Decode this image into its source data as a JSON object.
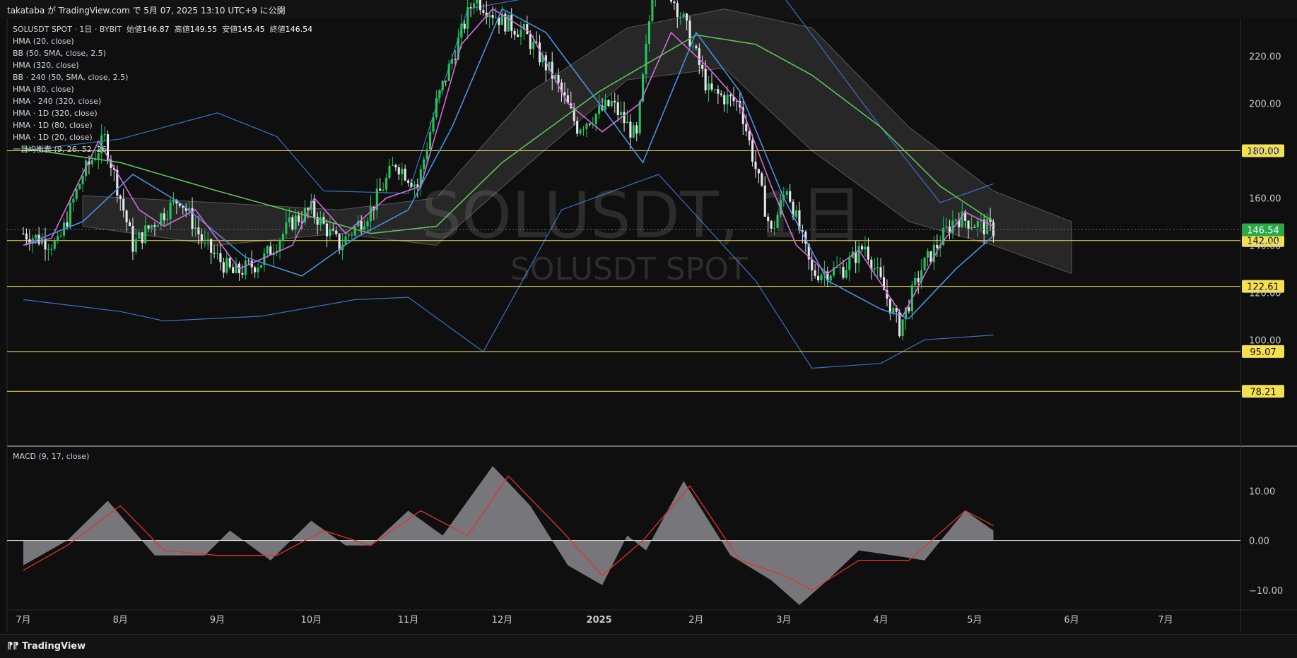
{
  "header": {
    "published": "takataba が TradingView.com で 5月 07, 2025 13:10 UTC+9 に公開"
  },
  "footer": {
    "brand": "TradingView"
  },
  "legend": {
    "symbol": "SOLUSDT SPOT · 1日 · BYBIT",
    "open_label": "始値",
    "open": "146.87",
    "high_label": "高値",
    "high": "149.55",
    "low_label": "安値",
    "low": "145.45",
    "close_label": "終値",
    "close": "146.54",
    "indicators": [
      "HMA (20, close)",
      "BB (50, SMA, close, 2.5)",
      "HMA (320, close)",
      "BB · 240 (50, SMA, close, 2.5)",
      "HMA (80, close)",
      "HMA · 240 (320, close)",
      "HMA · 1D (320, close)",
      "HMA · 1D (80, close)",
      "HMA · 1D (20, close)",
      "一目均衡表 (9, 26, 52, 26)"
    ]
  },
  "watermark": {
    "main": "SOLUSDT, 1日",
    "sub": "SOLUSDT SPOT"
  },
  "macd": {
    "title": "MACD (9, 17, close)"
  },
  "colors": {
    "up": "#22c55e",
    "down": "#e5e7eb",
    "hma20": "#d16bd8",
    "hma80": "#4a90e2",
    "hma320": "#5cc15c",
    "bb": "#3f6fc4",
    "level": "#f5e050",
    "price_tag": "#2aa84a",
    "macd_line": "#e03030",
    "hist": "#8a8a8e"
  },
  "chart_data": {
    "type": "candlestick",
    "title": "SOLUSDT, 1日",
    "price_axis": {
      "range": [
        55,
        236
      ],
      "ticks": [
        100,
        120,
        140,
        160,
        180,
        200,
        220
      ],
      "tick_labels": [
        "100.00",
        "120.00",
        "140.00",
        "160.00",
        "180.00",
        "200.00",
        "220.00"
      ]
    },
    "time_axis": {
      "labels": [
        "7月",
        "8月",
        "9月",
        "10月",
        "11月",
        "12月",
        "2025",
        "2月",
        "3月",
        "4月",
        "5月",
        "6月",
        "7月"
      ]
    },
    "current_price": {
      "value": 146.54,
      "label": "146.54"
    },
    "horizontal_levels": [
      {
        "value": 180.0,
        "label": "180.00"
      },
      {
        "value": 142.0,
        "label": "142.00"
      },
      {
        "value": 122.61,
        "label": "122.61"
      },
      {
        "value": 95.07,
        "label": "95.07"
      },
      {
        "value": 78.21,
        "label": "78.21"
      }
    ],
    "months": [
      "2024-07",
      "2024-08",
      "2024-09",
      "2024-10",
      "2024-11",
      "2024-12",
      "2025-01",
      "2025-02",
      "2025-03",
      "2025-04",
      "2025-05"
    ],
    "price_path": [
      [
        "2024-07-01",
        145
      ],
      [
        "2024-07-12",
        140
      ],
      [
        "2024-07-20",
        170
      ],
      [
        "2024-07-27",
        185
      ],
      [
        "2024-08-05",
        140
      ],
      [
        "2024-08-12",
        150
      ],
      [
        "2024-08-20",
        160
      ],
      [
        "2024-08-28",
        140
      ],
      [
        "2024-09-06",
        128
      ],
      [
        "2024-09-15",
        133
      ],
      [
        "2024-09-25",
        150
      ],
      [
        "2024-10-01",
        155
      ],
      [
        "2024-10-10",
        140
      ],
      [
        "2024-10-20",
        155
      ],
      [
        "2024-10-28",
        175
      ],
      [
        "2024-11-04",
        165
      ],
      [
        "2024-11-10",
        200
      ],
      [
        "2024-11-22",
        245
      ],
      [
        "2024-12-01",
        235
      ],
      [
        "2024-12-08",
        230
      ],
      [
        "2024-12-18",
        210
      ],
      [
        "2024-12-25",
        190
      ],
      [
        "2025-01-05",
        200
      ],
      [
        "2025-01-13",
        185
      ],
      [
        "2025-01-19",
        260
      ],
      [
        "2025-01-28",
        235
      ],
      [
        "2025-02-05",
        205
      ],
      [
        "2025-02-15",
        200
      ],
      [
        "2025-02-25",
        145
      ],
      [
        "2025-03-02",
        165
      ],
      [
        "2025-03-10",
        128
      ],
      [
        "2025-03-20",
        130
      ],
      [
        "2025-03-27",
        140
      ],
      [
        "2025-04-07",
        105
      ],
      [
        "2025-04-14",
        130
      ],
      [
        "2025-04-25",
        152
      ],
      [
        "2025-05-07",
        146.54
      ]
    ],
    "hma20": [
      [
        "2024-07-01",
        140
      ],
      [
        "2024-07-10",
        143
      ],
      [
        "2024-07-25",
        184
      ],
      [
        "2024-08-07",
        155
      ],
      [
        "2024-08-15",
        148
      ],
      [
        "2024-08-25",
        155
      ],
      [
        "2024-09-08",
        130
      ],
      [
        "2024-09-25",
        140
      ],
      [
        "2024-10-02",
        160
      ],
      [
        "2024-10-12",
        145
      ],
      [
        "2024-10-25",
        160
      ],
      [
        "2024-11-05",
        165
      ],
      [
        "2024-11-18",
        225
      ],
      [
        "2024-11-28",
        240
      ],
      [
        "2024-12-10",
        230
      ],
      [
        "2024-12-22",
        200
      ],
      [
        "2025-01-02",
        188
      ],
      [
        "2025-01-14",
        200
      ],
      [
        "2025-01-24",
        230
      ],
      [
        "2025-02-05",
        215
      ],
      [
        "2025-02-15",
        200
      ],
      [
        "2025-02-25",
        165
      ],
      [
        "2025-03-05",
        140
      ],
      [
        "2025-03-15",
        128
      ],
      [
        "2025-03-25",
        138
      ],
      [
        "2025-04-08",
        110
      ],
      [
        "2025-04-20",
        140
      ],
      [
        "2025-04-28",
        154
      ],
      [
        "2025-05-07",
        148
      ]
    ],
    "hma80": [
      [
        "2024-07-01",
        140
      ],
      [
        "2024-07-20",
        150
      ],
      [
        "2024-08-05",
        170
      ],
      [
        "2024-08-20",
        158
      ],
      [
        "2024-09-10",
        135
      ],
      [
        "2024-09-28",
        127
      ],
      [
        "2024-10-15",
        143
      ],
      [
        "2024-11-01",
        155
      ],
      [
        "2024-11-15",
        190
      ],
      [
        "2024-12-01",
        240
      ],
      [
        "2024-12-15",
        230
      ],
      [
        "2025-01-01",
        200
      ],
      [
        "2025-01-15",
        175
      ],
      [
        "2025-02-01",
        230
      ],
      [
        "2025-02-15",
        205
      ],
      [
        "2025-03-01",
        160
      ],
      [
        "2025-03-15",
        125
      ],
      [
        "2025-04-01",
        113
      ],
      [
        "2025-04-10",
        109
      ],
      [
        "2025-04-25",
        130
      ],
      [
        "2025-05-07",
        144
      ]
    ],
    "hma320": [
      [
        "2024-07-01",
        181
      ],
      [
        "2024-08-01",
        175
      ],
      [
        "2024-09-01",
        163
      ],
      [
        "2024-10-01",
        152
      ],
      [
        "2024-10-20",
        145
      ],
      [
        "2024-11-10",
        148
      ],
      [
        "2024-12-01",
        175
      ],
      [
        "2025-01-01",
        205
      ],
      [
        "2025-02-01",
        229
      ],
      [
        "2025-02-20",
        225
      ],
      [
        "2025-03-10",
        212
      ],
      [
        "2025-04-01",
        190
      ],
      [
        "2025-04-20",
        165
      ],
      [
        "2025-05-07",
        150
      ]
    ],
    "bb_upper": [
      [
        "2024-07-01",
        180
      ],
      [
        "2024-08-01",
        185
      ],
      [
        "2024-09-01",
        196
      ],
      [
        "2024-09-20",
        186
      ],
      [
        "2024-10-05",
        163
      ],
      [
        "2024-11-01",
        162
      ],
      [
        "2024-11-20",
        240
      ],
      [
        "2025-01-01",
        250
      ],
      [
        "2025-02-01",
        250
      ],
      [
        "2025-03-01",
        245
      ],
      [
        "2025-04-01",
        190
      ],
      [
        "2025-04-20",
        158
      ],
      [
        "2025-05-07",
        166
      ]
    ],
    "bb_lower": [
      [
        "2024-07-01",
        117
      ],
      [
        "2024-08-01",
        112
      ],
      [
        "2024-08-15",
        108
      ],
      [
        "2024-09-15",
        110
      ],
      [
        "2024-10-15",
        117
      ],
      [
        "2024-11-01",
        118
      ],
      [
        "2024-11-25",
        95
      ],
      [
        "2024-12-20",
        155
      ],
      [
        "2025-01-20",
        170
      ],
      [
        "2025-02-20",
        125
      ],
      [
        "2025-03-10",
        88
      ],
      [
        "2025-04-01",
        90
      ],
      [
        "2025-04-15",
        100
      ],
      [
        "2025-05-07",
        102
      ]
    ],
    "ichimoku_cloud": {
      "upper": [
        [
          "2024-07-20",
          161
        ],
        [
          "2024-09-01",
          158
        ],
        [
          "2024-10-10",
          155
        ],
        [
          "2024-11-10",
          160
        ],
        [
          "2024-12-10",
          205
        ],
        [
          "2025-01-10",
          232
        ],
        [
          "2025-02-10",
          240
        ],
        [
          "2025-03-10",
          232
        ],
        [
          "2025-04-10",
          190
        ],
        [
          "2025-05-07",
          163
        ],
        [
          "2025-06-01",
          150
        ]
      ],
      "lower": [
        [
          "2024-07-20",
          148
        ],
        [
          "2024-09-01",
          140
        ],
        [
          "2024-10-10",
          145
        ],
        [
          "2024-11-10",
          140
        ],
        [
          "2024-12-10",
          175
        ],
        [
          "2025-01-10",
          210
        ],
        [
          "2025-02-10",
          215
        ],
        [
          "2025-03-10",
          180
        ],
        [
          "2025-04-10",
          150
        ],
        [
          "2025-05-07",
          140
        ],
        [
          "2025-06-01",
          128
        ]
      ]
    },
    "macd": {
      "axis": {
        "range": [
          -14,
          19
        ],
        "ticks": [
          -10,
          0,
          10
        ],
        "tick_labels": [
          "−10.00",
          "0.00",
          "10.00"
        ]
      },
      "histogram_path": [
        [
          "2024-07-01",
          -5
        ],
        [
          "2024-07-15",
          0
        ],
        [
          "2024-07-28",
          8
        ],
        [
          "2024-08-12",
          -3
        ],
        [
          "2024-08-28",
          -3
        ],
        [
          "2024-09-05",
          2
        ],
        [
          "2024-09-18",
          -4
        ],
        [
          "2024-10-01",
          4
        ],
        [
          "2024-10-12",
          -1
        ],
        [
          "2024-10-20",
          -1
        ],
        [
          "2024-11-01",
          6
        ],
        [
          "2024-11-12",
          1
        ],
        [
          "2024-11-28",
          15
        ],
        [
          "2024-12-10",
          7
        ],
        [
          "2024-12-22",
          -5
        ],
        [
          "2025-01-02",
          -9
        ],
        [
          "2025-01-10",
          1
        ],
        [
          "2025-01-16",
          -2
        ],
        [
          "2025-01-28",
          12
        ],
        [
          "2025-02-12",
          -3
        ],
        [
          "2025-02-25",
          -8
        ],
        [
          "2025-03-06",
          -13
        ],
        [
          "2025-03-15",
          -8
        ],
        [
          "2025-03-25",
          -2
        ],
        [
          "2025-04-05",
          -3
        ],
        [
          "2025-04-15",
          -4
        ],
        [
          "2025-04-28",
          6
        ],
        [
          "2025-05-07",
          2
        ]
      ],
      "signal_path": [
        [
          "2024-07-01",
          -6
        ],
        [
          "2024-07-15",
          -1
        ],
        [
          "2024-08-01",
          7
        ],
        [
          "2024-08-15",
          -2
        ],
        [
          "2024-09-01",
          -3
        ],
        [
          "2024-09-20",
          -3
        ],
        [
          "2024-10-05",
          2
        ],
        [
          "2024-10-20",
          -1
        ],
        [
          "2024-11-05",
          6
        ],
        [
          "2024-11-20",
          1
        ],
        [
          "2024-12-03",
          13
        ],
        [
          "2024-12-20",
          2
        ],
        [
          "2025-01-02",
          -7
        ],
        [
          "2025-01-15",
          0
        ],
        [
          "2025-01-30",
          11
        ],
        [
          "2025-02-15",
          -4
        ],
        [
          "2025-03-01",
          -7
        ],
        [
          "2025-03-10",
          -10
        ],
        [
          "2025-03-25",
          -4
        ],
        [
          "2025-04-10",
          -4
        ],
        [
          "2025-04-28",
          6
        ],
        [
          "2025-05-07",
          3
        ]
      ]
    }
  }
}
